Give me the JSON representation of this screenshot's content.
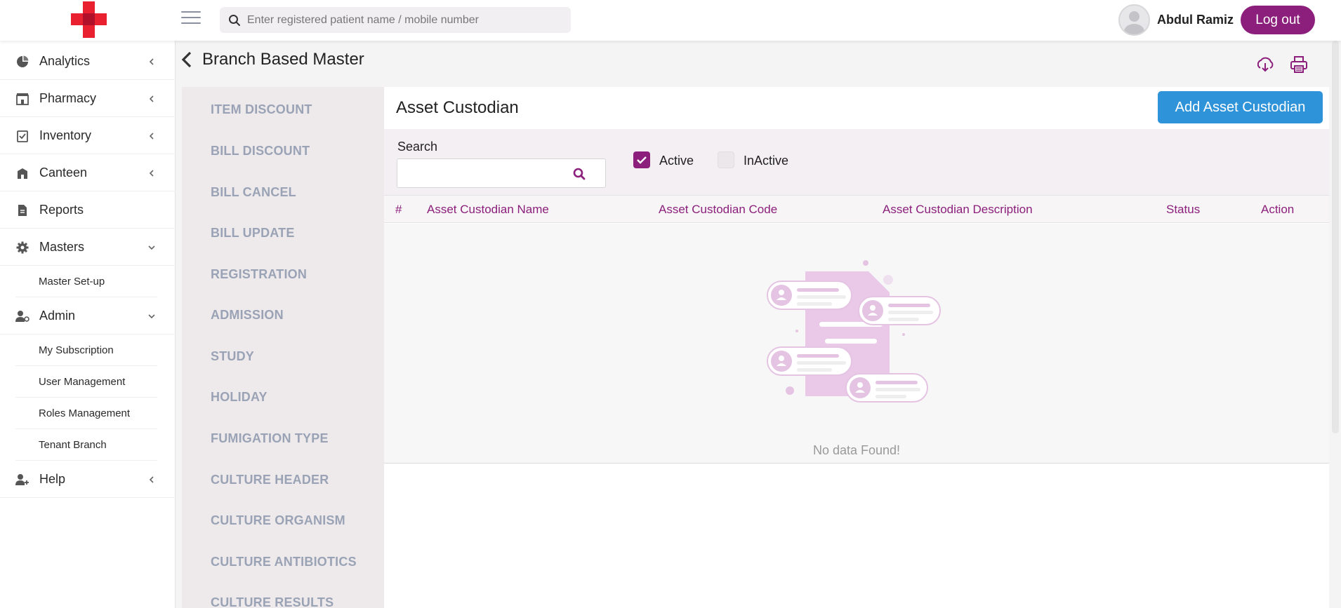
{
  "topbar": {
    "search_placeholder": "Enter registered patient name / mobile number",
    "username": "Abdul Ramiz",
    "logout_label": "Log out"
  },
  "sidebar": {
    "items": [
      {
        "label": "Analytics",
        "icon": "pie-chart-icon"
      },
      {
        "label": "Pharmacy",
        "icon": "pharmacy-store-icon"
      },
      {
        "label": "Inventory",
        "icon": "clipboard-check-icon"
      },
      {
        "label": "Canteen",
        "icon": "building-icon"
      },
      {
        "label": "Reports",
        "icon": "document-icon"
      },
      {
        "label": "Masters",
        "icon": "gear-icon"
      },
      {
        "label": "Admin",
        "icon": "user-gear-icon"
      },
      {
        "label": "Help",
        "icon": "user-plus-icon"
      }
    ],
    "masters_sub": [
      "Master Set-up"
    ],
    "admin_sub": [
      "My Subscription",
      "User Management",
      "Roles Management",
      "Tenant Branch"
    ]
  },
  "page": {
    "title": "Branch Based Master"
  },
  "master_list": [
    "ITEM DISCOUNT",
    "BILL DISCOUNT",
    "BILL CANCEL",
    "BILL UPDATE",
    "REGISTRATION",
    "ADMISSION",
    "STUDY",
    "HOLIDAY",
    "FUMIGATION TYPE",
    "CULTURE HEADER",
    "CULTURE ORGANISM",
    "CULTURE ANTIBIOTICS",
    "CULTURE RESULTS"
  ],
  "content": {
    "title": "Asset Custodian",
    "add_button": "Add Asset Custodian",
    "search_label": "Search",
    "filter_active": "Active",
    "filter_inactive": "InActive",
    "active_checked": true,
    "inactive_checked": false,
    "columns": [
      "#",
      "Asset Custodian Name",
      "Asset Custodian Code",
      "Asset Custodian Description",
      "Status",
      "Action"
    ],
    "rows": [],
    "empty_text": "No data Found!"
  },
  "colors": {
    "brand": "#8b1f7b",
    "primary_button": "#2f93d9",
    "logo_red": "#e8202f",
    "muted_text": "#9aa3b6"
  }
}
